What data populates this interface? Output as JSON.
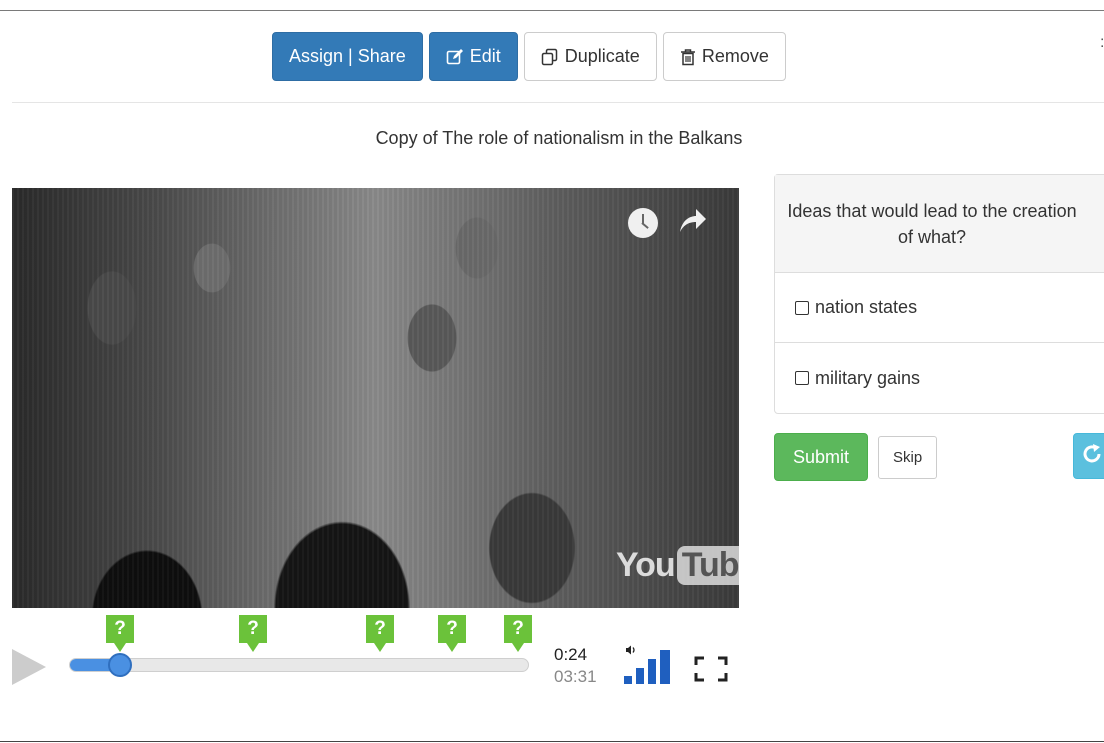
{
  "toolbar": {
    "assign_label": "Assign | Share",
    "edit_label": "Edit",
    "duplicate_label": "Duplicate",
    "remove_label": "Remove"
  },
  "lesson": {
    "title": "Copy of The role of nationalism in the Balkans"
  },
  "video": {
    "logo_text_you": "You",
    "logo_text_tube": "Tube",
    "question_marker_label": "?",
    "question_markers_count": 5,
    "progress_fraction": 0.11,
    "current_time": "0:24",
    "duration": "03:31"
  },
  "question": {
    "prompt": "Ideas that would lead to the creation of what?",
    "options": [
      "nation states",
      "military gains"
    ],
    "submit_label": "Submit",
    "skip_label": "Skip"
  },
  "colors": {
    "primary": "#337ab7",
    "success": "#5cb85c",
    "info": "#5bc0de",
    "marker": "#6bc23a",
    "progress": "#4a90e2"
  }
}
